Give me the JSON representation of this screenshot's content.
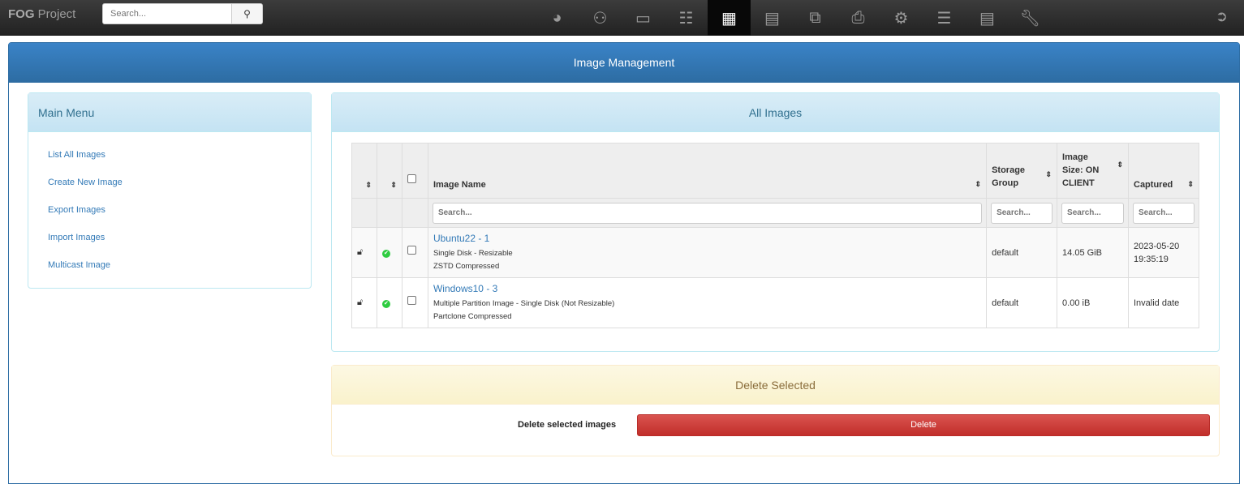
{
  "nav": {
    "brand_bold": "FOG",
    "brand_rest": " Project",
    "search_placeholder": "Search...",
    "icons": [
      "dashboard-icon",
      "users-icon",
      "computer-icon",
      "sitemap-icon",
      "image-icon",
      "archive-icon",
      "copy-icon",
      "printer-icon",
      "cogs-icon",
      "server-icon",
      "file-icon",
      "wrench-icon"
    ],
    "active": "image-icon"
  },
  "page": {
    "title": "Image Management"
  },
  "menu": {
    "title": "Main Menu",
    "items": [
      "List All Images",
      "Create New Image",
      "Export Images",
      "Import Images",
      "Multicast Image"
    ]
  },
  "images": {
    "title": "All Images",
    "headers": {
      "name": "Image Name",
      "storage": "Storage Group",
      "size": "Image Size: ON CLIENT",
      "captured": "Captured"
    },
    "search_placeholder": "Search...",
    "rows": [
      {
        "name": "Ubuntu22 - 1",
        "type": "Single Disk - Resizable",
        "compression": "ZSTD Compressed",
        "storage": "default",
        "size": "14.05 GiB",
        "captured": "2023-05-20 19:35:19"
      },
      {
        "name": "Windows10 - 3",
        "type": "Multiple Partition Image - Single Disk (Not Resizable)",
        "compression": "Partclone Compressed",
        "storage": "default",
        "size": "0.00 iB",
        "captured": "Invalid date"
      }
    ]
  },
  "delete": {
    "title": "Delete Selected",
    "label": "Delete selected images",
    "button": "Delete"
  },
  "colors": {
    "primary": "#337ab7",
    "danger": "#d9534f",
    "ok": "#2ecc40"
  }
}
